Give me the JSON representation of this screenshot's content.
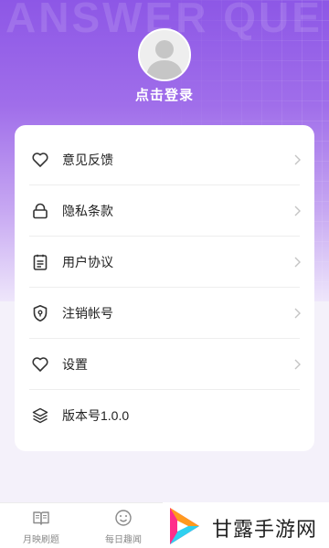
{
  "header": {
    "watermark_text": "ANSWER QUE",
    "login_label": "点击登录"
  },
  "menu": {
    "items": [
      {
        "label": "意见反馈",
        "icon": "heart-icon"
      },
      {
        "label": "隐私条款",
        "icon": "lock-icon"
      },
      {
        "label": "用户协议",
        "icon": "clipboard-icon"
      },
      {
        "label": "注销帐号",
        "icon": "shield-icon"
      },
      {
        "label": "设置",
        "icon": "heart-icon"
      },
      {
        "label": "版本号1.0.0",
        "icon": "layers-icon"
      }
    ]
  },
  "tabbar": {
    "tabs": [
      {
        "label": "月映刷题",
        "icon": "book-icon"
      },
      {
        "label": "每日趣闻",
        "icon": "smile-icon"
      }
    ]
  },
  "brand_overlay": {
    "text": "甘露手游网"
  },
  "colors": {
    "accent": "#8d57e6",
    "card_bg": "#ffffff",
    "text_primary": "#222222",
    "tab_text": "#8a8a8a"
  }
}
